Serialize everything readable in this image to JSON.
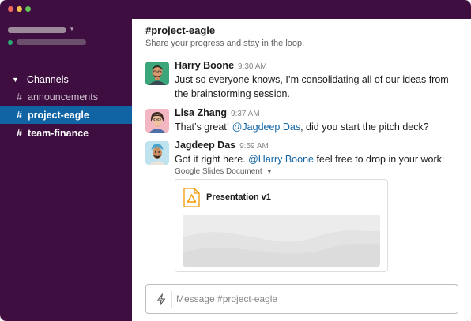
{
  "window": {
    "controls": [
      "close",
      "minimize",
      "zoom"
    ]
  },
  "sidebar": {
    "section_label": "Channels",
    "channels": [
      {
        "name": "announcements",
        "state": "normal"
      },
      {
        "name": "project-eagle",
        "state": "active"
      },
      {
        "name": "team-finance",
        "state": "unread"
      }
    ],
    "hash_symbol": "#"
  },
  "channel": {
    "title": "#project-eagle",
    "topic": "Share your progress and stay in the loop."
  },
  "messages": [
    {
      "author": "Harry Boone",
      "time": "9:30 AM",
      "text": "Just so everyone knows, I’m consolidating all of our ideas from the brainstorming session."
    },
    {
      "author": "Lisa Zhang",
      "time": "9:37 AM",
      "text_before": "That’s great! ",
      "mention": "@Jagdeep Das",
      "text_after": ", did you start the pitch deck?"
    },
    {
      "author": "Jagdeep Das",
      "time": "9:59 AM",
      "text_before": "Got it right here. ",
      "mention": "@Harry Boone",
      "text_after": " feel free to drop in your work:",
      "attachment": {
        "type_label": "Google Slides Document",
        "title": "Presentation v1",
        "icon": "google-slides-icon"
      }
    }
  ],
  "composer": {
    "placeholder": "Message #project-eagle",
    "icon": "shortcuts-bolt-icon"
  },
  "colors": {
    "sidebar_bg": "#3f0e40",
    "active_channel": "#1164a3",
    "mention": "#1264a3",
    "presence": "#2bac76"
  }
}
